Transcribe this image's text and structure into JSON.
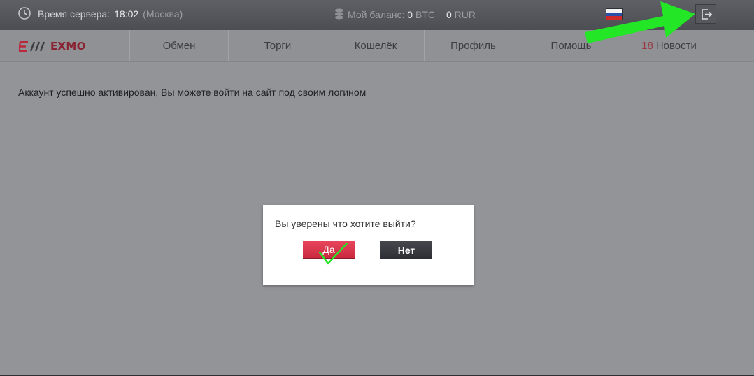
{
  "topbar": {
    "server_time_label": "Время сервера:",
    "server_time": "18:02",
    "server_city": "(Москва)",
    "balance_label": "Мой баланс:",
    "balance_btc_value": "0",
    "balance_btc_unit": "BTC",
    "balance_rur_value": "0",
    "balance_rur_unit": "RUR",
    "language": "ru-flag-icon",
    "logout_icon": "logout-icon"
  },
  "logo": {
    "text": "EXMO"
  },
  "nav": {
    "items": [
      {
        "label": "Обмен"
      },
      {
        "label": "Торги"
      },
      {
        "label": "Кошелёк"
      },
      {
        "label": "Профиль"
      },
      {
        "label": "Помощь"
      },
      {
        "label": "Новости",
        "badge": "18"
      }
    ]
  },
  "content": {
    "message": "Аккаунт успешно активирован, Вы можете войти на сайт под своим логином"
  },
  "modal": {
    "question": "Вы уверены что хотите выйти?",
    "yes_label": "Да",
    "no_label": "Нет"
  },
  "colors": {
    "accent": "#d4334a",
    "annotation": "#22e626",
    "overlay_bg": "#939498"
  }
}
